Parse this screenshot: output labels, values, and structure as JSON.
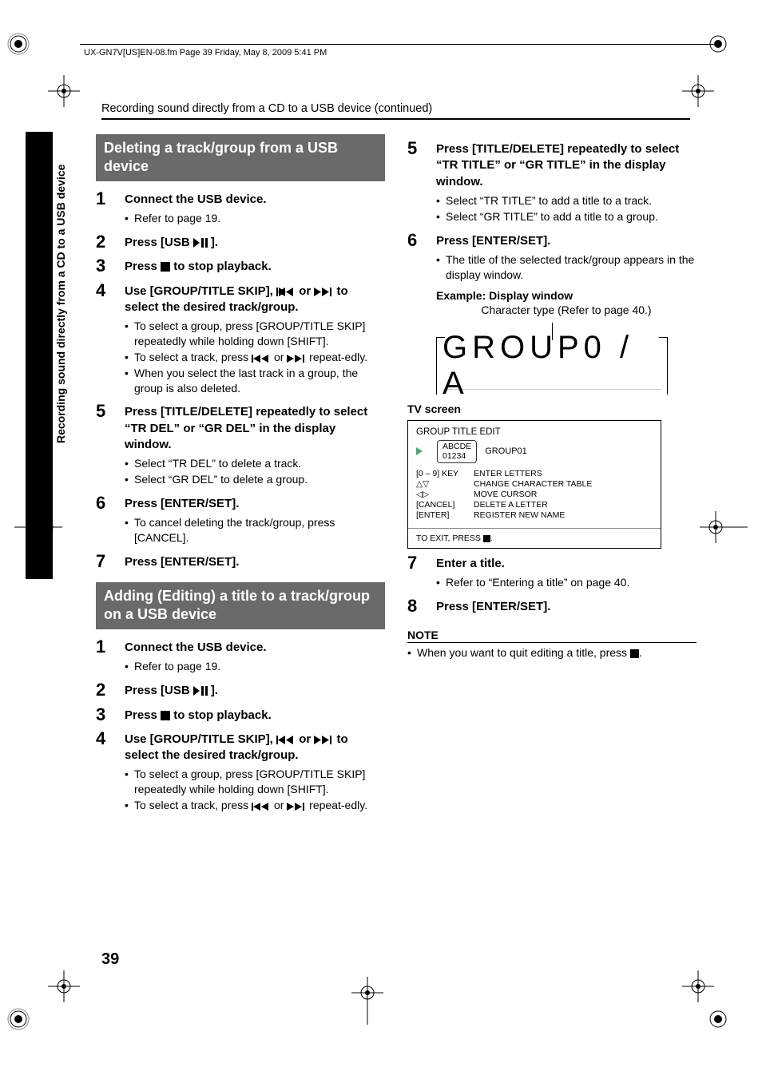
{
  "header_line": "UX-GN7V[US]EN-08.fm  Page 39  Friday, May 8, 2009  5:41 PM",
  "running_head": "Recording sound directly from a CD to a USB device (continued)",
  "side_text": "Recording sound directly from a CD to a USB device",
  "page_number": "39",
  "sec_a_heading": "Deleting a track/group from a USB device",
  "a1_title": "Connect the USB device.",
  "a1_b1": "Refer to page 19.",
  "a2_pre": "Press [USB ",
  "a2_post": "].",
  "a3_pre": "Press ",
  "a3_post": " to stop playback.",
  "a4_pre": "Use [GROUP/TITLE SKIP], ",
  "a4_mid": " or ",
  "a4_post": " to select the desired track/group.",
  "a4_b1": "To select a group, press [GROUP/TITLE SKIP] repeatedly while holding down [SHIFT].",
  "a4_b2_pre": "To select a track, press ",
  "a4_b2_mid": " or ",
  "a4_b2_post": " repeat-edly.",
  "a4_b3": "When you select the last track in a group, the group is also deleted.",
  "a5_title": "Press [TITLE/DELETE] repeatedly to select “TR DEL” or  “GR DEL” in the display window.",
  "a5_b1": "Select “TR DEL” to delete a track.",
  "a5_b2": "Select “GR DEL” to delete a group.",
  "a6_title": "Press [ENTER/SET].",
  "a6_b1": "To cancel deleting the track/group, press [CANCEL].",
  "a7_title": "Press [ENTER/SET].",
  "sec_b_heading": "Adding (Editing) a title to a track/group on a USB device",
  "b1_title": "Connect the USB device.",
  "b1_b1": "Refer to page 19.",
  "b2_pre": "Press [USB ",
  "b2_post": "].",
  "b3_pre": "Press ",
  "b3_post": " to stop playback.",
  "b4_pre": "Use [GROUP/TITLE SKIP], ",
  "b4_mid": " or ",
  "b4_post": " to select the desired track/group.",
  "b4_b1": "To select a group, press [GROUP/TITLE SKIP] repeatedly while holding down [SHIFT].",
  "b4_b2_pre": "To select a track, press ",
  "b4_b2_mid": " or ",
  "b4_b2_post": " repeat-edly.",
  "r5_title": "Press [TITLE/DELETE] repeatedly to select “TR TITLE” or “GR TITLE” in the display window.",
  "r5_b1": "Select “TR TITLE” to add a title to a track.",
  "r5_b2": "Select “GR TITLE” to add a title to a group.",
  "r6_title": "Press [ENTER/SET].",
  "r6_b1": "The title of the selected track/group appears in the display window.",
  "r6_example_label": "Example: Display window",
  "r6_example_caption": "Character type (Refer to page 40.)",
  "r6_lcd_text": "GROUP0 / A",
  "tv_label": "TV screen",
  "tv_title": "GROUP TITLE EDIT",
  "tv_chip_l1": "ABCDE",
  "tv_chip_l2": "01234",
  "tv_grp": "GROUP01",
  "tv_k1": "[0 – 9] KEY",
  "tv_v1": "ENTER LETTERS",
  "tv_k2": "△▽",
  "tv_v2": "CHANGE CHARACTER TABLE",
  "tv_k3": "◁▷",
  "tv_v3": "MOVE CURSOR",
  "tv_k4": "[CANCEL]",
  "tv_v4": "DELETE A LETTER",
  "tv_k5": "[ENTER]",
  "tv_v5": "REGISTER NEW NAME",
  "tv_exit_pre": "TO EXIT, PRESS ",
  "tv_exit_post": ".",
  "r7_title": "Enter a title.",
  "r7_b1": "Refer to “Entering a title” on page 40.",
  "r8_title": "Press [ENTER/SET].",
  "note_head": "NOTE",
  "note_body_pre": "When you want to quit editing a title, press ",
  "note_body_post": "."
}
